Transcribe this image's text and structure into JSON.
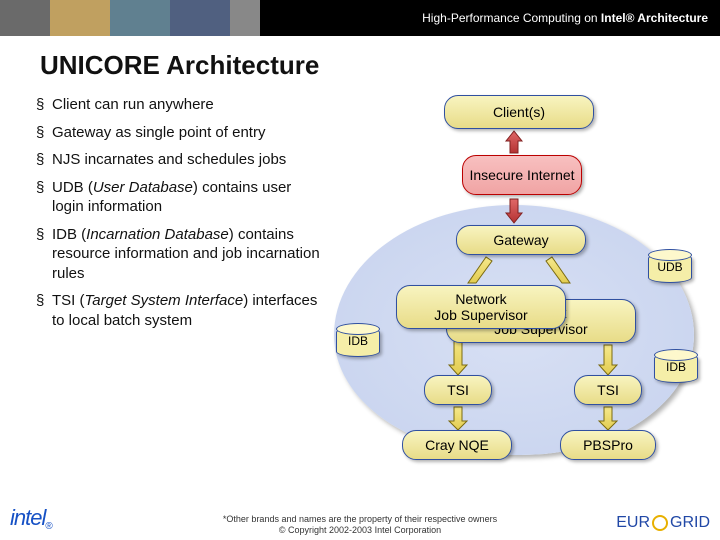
{
  "header": {
    "label_prefix": "High-Performance Computing on ",
    "label_bold": "Intel® Architecture"
  },
  "title": "UNICORE Architecture",
  "bullets": [
    "Client can run anywhere",
    "Gateway as single point of entry",
    "NJS incarnates and schedules jobs",
    "UDB (<i>User Database</i>) contains user login information",
    "IDB (<i>Incarnation Database</i>) contains resource information and job incarnation rules",
    "TSI (<i>Target System Interface</i>) interfaces to local batch system"
  ],
  "diagram": {
    "clients": "Client(s)",
    "insecure": "Insecure Internet",
    "gateway": "Gateway",
    "njs1_l1": "Network",
    "njs1_l2": "Job Supervisor",
    "njs2_l1": "Network",
    "njs2_l2": "Job Supervisor",
    "tsi": "TSI",
    "batch1": "Cray NQE",
    "batch2": "PBSPro",
    "idb": "IDB",
    "udb": "UDB"
  },
  "footer": {
    "line1": "*Other brands and names are the property of their respective owners",
    "line2": "© Copyright 2002-2003 Intel Corporation"
  },
  "logos": {
    "intel": "intel",
    "eurogrid": "EUR  GRID"
  }
}
